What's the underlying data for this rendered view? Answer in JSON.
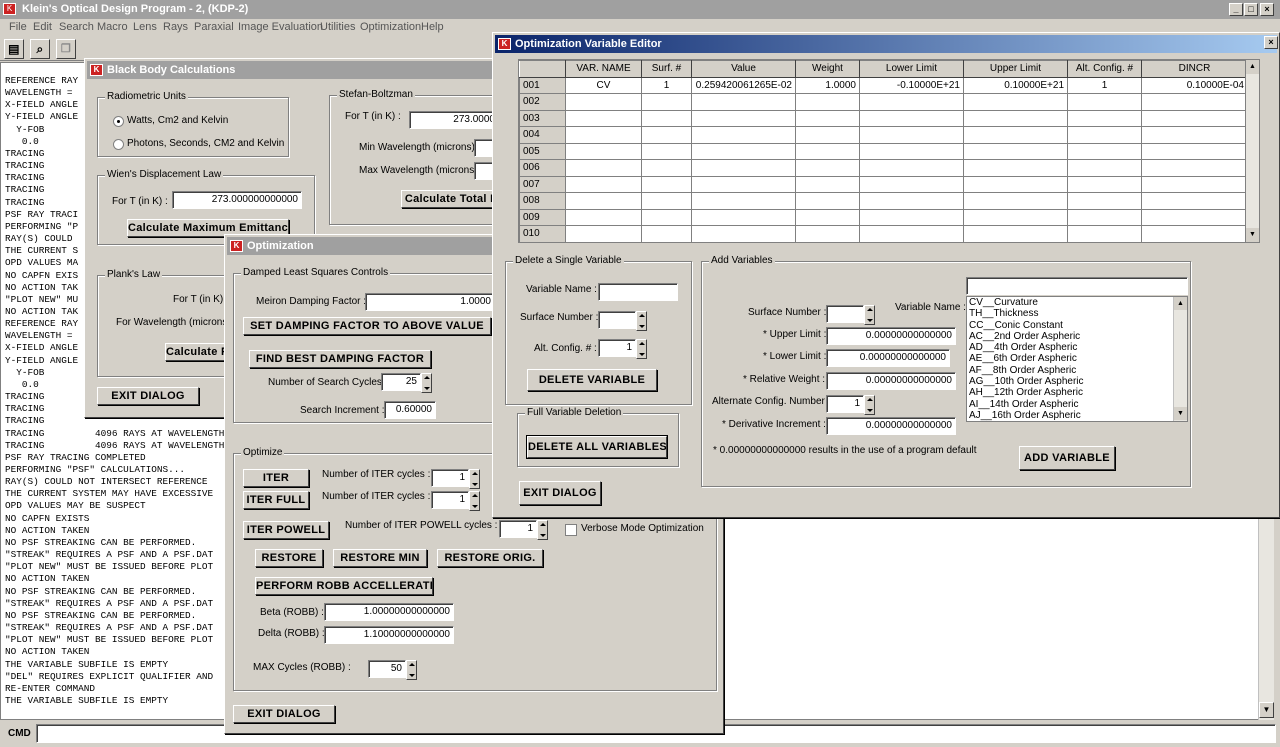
{
  "app": {
    "title": "Klein's Optical Design Program - 2,  (KDP-2)",
    "menu": [
      "File",
      "Edit",
      "Search",
      "Macro",
      "Lens",
      "Rays",
      "Paraxial",
      "Image Evaluation",
      "Utilities",
      "Optimization",
      "Help"
    ],
    "cmd_label": "CMD",
    "cmd_value": ""
  },
  "console_lines": [
    "REFERENCE RAY",
    "WAVELENGTH =",
    "X-FIELD ANGLE",
    "Y-FIELD ANGLE",
    "  Y-FOB",
    "   0.0",
    "TRACING",
    "TRACING",
    "TRACING",
    "TRACING",
    "TRACING",
    "PSF RAY TRACI",
    "PERFORMING \"P",
    "RAY(S) COULD",
    "THE CURRENT S",
    "OPD VALUES MA",
    "NO CAPFN EXIS",
    "NO ACTION TAK",
    "\"PLOT NEW\" MU",
    "NO ACTION TAK",
    "REFERENCE RAY",
    "WAVELENGTH =",
    "X-FIELD ANGLE",
    "Y-FIELD ANGLE",
    "  Y-FOB",
    "   0.0",
    "TRACING",
    "TRACING",
    "TRACING",
    "TRACING         4096 RAYS AT WAVELENGTH",
    "TRACING         4096 RAYS AT WAVELENGTH",
    "PSF RAY TRACING COMPLETED",
    "PERFORMING \"PSF\" CALCULATIONS...",
    "RAY(S) COULD NOT INTERSECT REFERENCE",
    "THE CURRENT SYSTEM MAY HAVE EXCESSIVE",
    "OPD VALUES MAY BE SUSPECT",
    "NO CAPFN EXISTS",
    "NO ACTION TAKEN",
    "NO PSF STREAKING CAN BE PERFORMED.",
    "\"STREAK\" REQUIRES A PSF AND A PSF.DAT",
    "\"PLOT NEW\" MUST BE ISSUED BEFORE PLOT",
    "NO ACTION TAKEN",
    "NO PSF STREAKING CAN BE PERFORMED.",
    "\"STREAK\" REQUIRES A PSF AND A PSF.DAT",
    "NO PSF STREAKING CAN BE PERFORMED.",
    "\"STREAK\" REQUIRES A PSF AND A PSF.DAT",
    "\"PLOT NEW\" MUST BE ISSUED BEFORE PLOT",
    "NO ACTION TAKEN",
    "THE VARIABLE SUBFILE IS EMPTY",
    "\"DEL\" REQUIRES EXPLICIT QUALIFIER AND",
    "RE-ENTER COMMAND",
    "THE VARIABLE SUBFILE IS EMPTY"
  ],
  "blackbody": {
    "title": "Black Body Calculations",
    "radiometric_units": "Radiometric Units",
    "unit_opt1": "Watts, Cm2 and Kelvin",
    "unit_opt2": "Photons, Seconds, CM2 and Kelvin",
    "wien": "Wien's Displacement Law",
    "wien_t_label": "For T (in K) :",
    "wien_t_value": "273.000000000000",
    "calc_max": "Calculate Maximum Emittance",
    "plank": "Plank's Law",
    "plank_t_label": "For T (in K) :",
    "plank_wl_label": "For Wavelength (microns)",
    "calc_plank": "Calculate F",
    "stefan": "Stefan-Boltzman",
    "stefan_t_label": "For T (in K) :",
    "stefan_t_value": "273.0000",
    "min_wl": "Min Wavelength (microns) :",
    "max_wl": "Max Wavelength (microns) :",
    "calc_total": "Calculate Total F",
    "exit": "EXIT DIALOG"
  },
  "opt": {
    "title": "Optimization",
    "dls": "Damped Least Squares Controls",
    "meiron_label": "Meiron Damping Factor :",
    "meiron_value": "1.0000",
    "set_damping": "SET DAMPING FACTOR TO ABOVE VALUE",
    "find_best": "FIND BEST DAMPING FACTOR",
    "search_cycles_label": "Number of Search Cycles :",
    "search_cycles": "25",
    "search_inc_label": "Search Increment :",
    "search_inc": "0.60000",
    "optimize": "Optimize",
    "iter": "ITER",
    "iter_full": "ITER FULL",
    "iter_powell": "ITER POWELL",
    "iter_cycles_label": "Number of ITER cycles :",
    "iter_cycles": "1",
    "iter_full_cycles_label": "Number of ITER cycles :",
    "iter_full_cycles": "1",
    "powell_label": "Number of ITER POWELL cycles :",
    "powell_cycles": "1",
    "verbose": "Verbose Mode Optimization",
    "restore": "RESTORE",
    "restore_min": "RESTORE MIN",
    "restore_orig": "RESTORE ORIG.",
    "robb": "PERFORM ROBB ACCELLERATION",
    "beta_label": "Beta (ROBB) :",
    "beta": "1.00000000000000",
    "delta_label": "Delta (ROBB) :",
    "delta": "1.10000000000000",
    "max_cycles_label": "MAX Cycles (ROBB) :",
    "max_cycles": "50",
    "exit": "EXIT DIALOG"
  },
  "ove": {
    "title": "Optimization Variable Editor",
    "columns": [
      "VAR. NAME",
      "Surf. #",
      "Value",
      "Weight",
      "Lower Limit",
      "Upper Limit",
      "Alt. Config. #",
      "DINCR"
    ],
    "rows": [
      {
        "id": "001",
        "cells": [
          "CV",
          "1",
          "0.259420061265E-02",
          "1.0000",
          "-0.10000E+21",
          "0.10000E+21",
          "1",
          "0.10000E-04"
        ]
      },
      {
        "id": "002",
        "cells": [
          "",
          "",
          "",
          "",
          "",
          "",
          "",
          ""
        ]
      },
      {
        "id": "003",
        "cells": [
          "",
          "",
          "",
          "",
          "",
          "",
          "",
          ""
        ]
      },
      {
        "id": "004",
        "cells": [
          "",
          "",
          "",
          "",
          "",
          "",
          "",
          ""
        ]
      },
      {
        "id": "005",
        "cells": [
          "",
          "",
          "",
          "",
          "",
          "",
          "",
          ""
        ]
      },
      {
        "id": "006",
        "cells": [
          "",
          "",
          "",
          "",
          "",
          "",
          "",
          ""
        ]
      },
      {
        "id": "007",
        "cells": [
          "",
          "",
          "",
          "",
          "",
          "",
          "",
          ""
        ]
      },
      {
        "id": "008",
        "cells": [
          "",
          "",
          "",
          "",
          "",
          "",
          "",
          ""
        ]
      },
      {
        "id": "009",
        "cells": [
          "",
          "",
          "",
          "",
          "",
          "",
          "",
          ""
        ]
      },
      {
        "id": "010",
        "cells": [
          "",
          "",
          "",
          "",
          "",
          "",
          "",
          ""
        ]
      }
    ],
    "del_single": "Delete a Single Variable",
    "var_name_label": "Variable Name :",
    "surf_num_label": "Surface Number :",
    "alt_config_label": "Alt. Config. # :",
    "alt_config_value": "1",
    "delete_variable": "DELETE VARIABLE",
    "full_del": "Full Variable Deletion",
    "delete_all": "DELETE ALL VARIABLES",
    "exit": "EXIT DIALOG",
    "add_vars": "Add Variables",
    "add_surf_label": "Surface Number :",
    "var_name2_label": "Variable Name :",
    "upper_label": "* Upper Limit :",
    "upper_value": "0.00000000000000",
    "lower_label": "* Lower Limit :",
    "lower_value": "0.00000000000000",
    "relw_label": "* Relative Weight :",
    "relw_value": "0.00000000000000",
    "altcfg_label": "Alternate Config. Number :",
    "altcfg_value": "1",
    "deriv_label": "*  Derivative Increment :",
    "deriv_value": "0.00000000000000",
    "footnote": "* 0.00000000000000 results in the use of a program default",
    "add_variable": "ADD VARIABLE",
    "var_list": [
      "CV__Curvature",
      "TH__Thickness",
      "CC__Conic Constant",
      "AC__2nd Order Aspheric",
      "AD__4th Order Aspheric",
      "AE__6th Order Aspheric",
      "AF__8th Order Aspheric",
      "AG__10th Order Aspheric",
      "AH__12th Order Aspheric",
      "AI__14th Order Aspheric",
      "AJ__16th Order Aspheric"
    ]
  }
}
